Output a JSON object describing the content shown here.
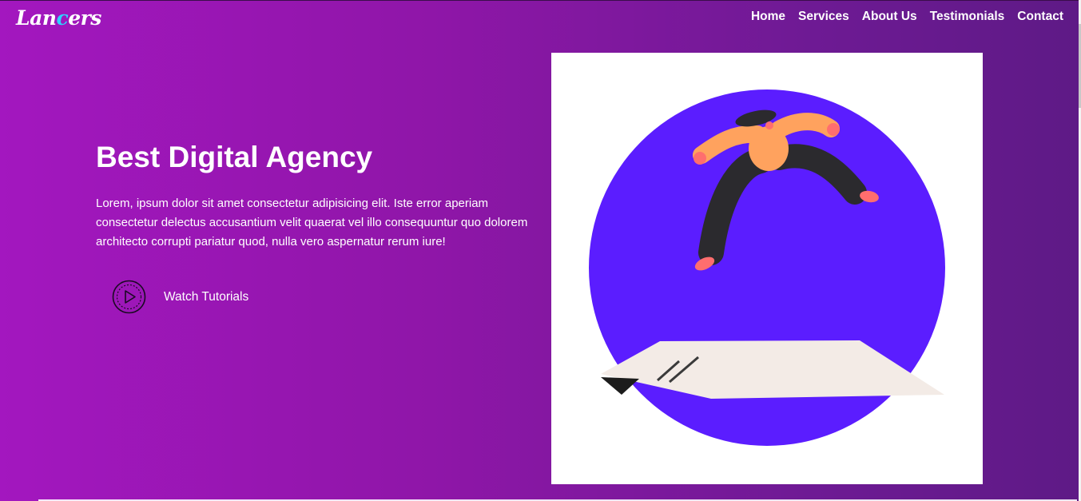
{
  "brand": {
    "logo_pre": "Lan",
    "logo_accent": "c",
    "logo_post": "ers",
    "accent_color": "#2fd3ff"
  },
  "nav": {
    "items": [
      "Home",
      "Services",
      "About Us",
      "Testimonials",
      "Contact"
    ]
  },
  "hero": {
    "title": "Best Digital Agency",
    "text": "Lorem, ipsum dolor sit amet consectetur adipisicing elit. Iste error aperiam consectetur delectus accusantium velit quaerat vel illo consequuntur quo dolorem architecto corrupti pariatur quod, nulla vero aspernatur rerum iure!",
    "cta_label": "Watch Tutorials",
    "cta_icon": "play-circle-icon"
  },
  "illustration": {
    "name": "person-jumping-illustration",
    "circle_color": "#5b1dff",
    "skin_color": "#ffa25e",
    "pants_color": "#2b2a2e",
    "paper_color": "#f3ebe6"
  },
  "theme": {
    "gradient_start": "#a317bf",
    "gradient_end": "#5e1a86"
  }
}
